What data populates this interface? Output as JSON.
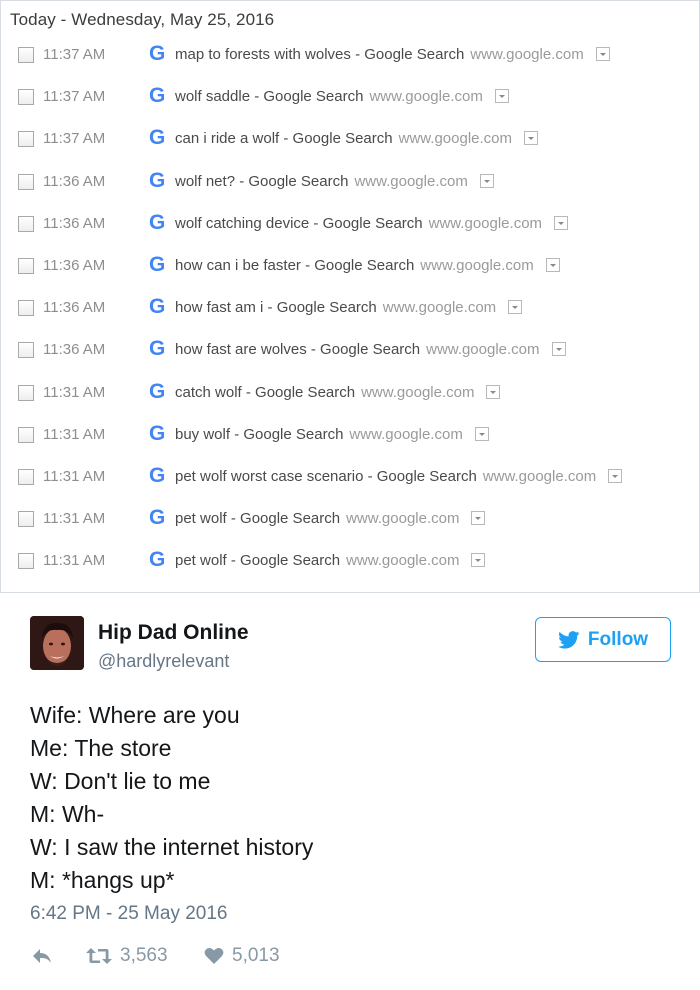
{
  "history": {
    "title": "Today - Wednesday, May 25, 2016",
    "entries": [
      {
        "time": "11:37 AM",
        "title": "map to forests with wolves - Google Search",
        "url": "www.google.com"
      },
      {
        "time": "11:37 AM",
        "title": "wolf saddle - Google Search",
        "url": "www.google.com"
      },
      {
        "time": "11:37 AM",
        "title": "can i ride a wolf - Google Search",
        "url": "www.google.com"
      },
      {
        "time": "11:36 AM",
        "title": "wolf net? - Google Search",
        "url": "www.google.com"
      },
      {
        "time": "11:36 AM",
        "title": "wolf catching device - Google Search",
        "url": "www.google.com"
      },
      {
        "time": "11:36 AM",
        "title": "how can i be faster - Google Search",
        "url": "www.google.com"
      },
      {
        "time": "11:36 AM",
        "title": "how fast am i - Google Search",
        "url": "www.google.com"
      },
      {
        "time": "11:36 AM",
        "title": "how fast are wolves - Google Search",
        "url": "www.google.com"
      },
      {
        "time": "11:31 AM",
        "title": "catch wolf - Google Search",
        "url": "www.google.com"
      },
      {
        "time": "11:31 AM",
        "title": "buy wolf - Google Search",
        "url": "www.google.com"
      },
      {
        "time": "11:31 AM",
        "title": "pet wolf worst case scenario - Google Search",
        "url": "www.google.com"
      },
      {
        "time": "11:31 AM",
        "title": "pet wolf - Google Search",
        "url": "www.google.com"
      },
      {
        "time": "11:31 AM",
        "title": "pet wolf - Google Search",
        "url": "www.google.com"
      }
    ],
    "favicon_icon": "google-g-icon",
    "favicon_letter": "G"
  },
  "tweet": {
    "display_name": "Hip Dad Online",
    "handle": "@hardlyrelevant",
    "follow_label": "Follow",
    "lines": [
      "Wife: Where are you",
      "Me: The store",
      "W: Don't lie to me",
      "M: Wh-",
      "W: I saw the internet history",
      "M: *hangs up*"
    ],
    "timestamp": "6:42 PM - 25 May 2016",
    "retweets": "3,563",
    "likes": "5,013"
  },
  "colors": {
    "twitter_blue": "#1da1f2",
    "google_blue": "#4285f4",
    "muted_gray": "#657786",
    "action_gray": "#8899a6"
  }
}
